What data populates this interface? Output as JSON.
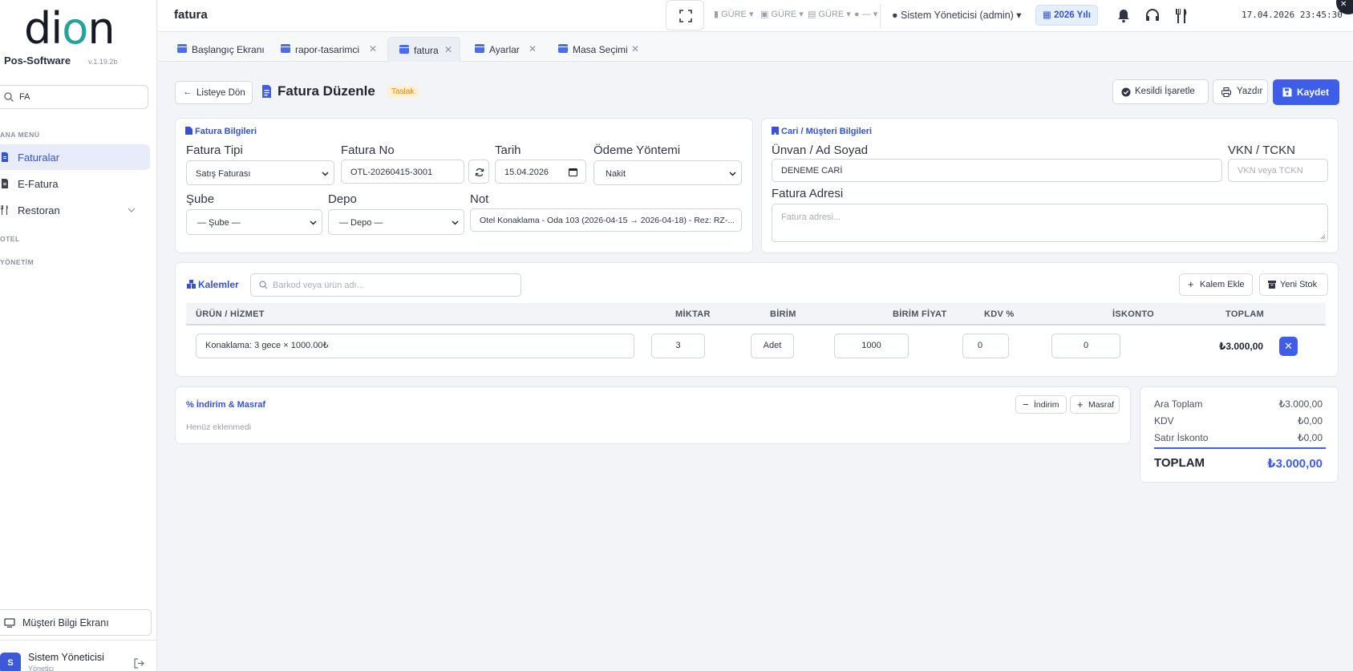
{
  "app": {
    "logo": "dion",
    "brand": "Pos-Software",
    "version": "v.1.19.2b"
  },
  "sidebar": {
    "search_value": "FA",
    "sections": [
      "ANA MENÜ",
      "OTEL",
      "YÖNETİM"
    ],
    "items": [
      {
        "label": "Faturalar",
        "icon": "file-invoice-icon",
        "active": true
      },
      {
        "label": "E-Fatura",
        "icon": "file-icon",
        "active": false
      },
      {
        "label": "Restoran",
        "icon": "utensils-icon",
        "active": false
      }
    ],
    "customer_screen": "Müşteri Bilgi Ekranı",
    "user": {
      "initial": "S",
      "name": "Sistem Yöneticisi",
      "role": "Yönetici"
    }
  },
  "topbar": {
    "title": "fatura",
    "stations": [
      "GÜRE",
      "GÜRE",
      "GÜRE",
      "—"
    ],
    "admin": "Sistem Yöneticisi (admin)",
    "year": "2026 Yılı",
    "clock": "17.04.2026 23:45:30"
  },
  "tabs": [
    {
      "label": "Başlangıç Ekranı",
      "closable": false
    },
    {
      "label": "rapor-tasarimci",
      "closable": true
    },
    {
      "label": "fatura",
      "closable": true,
      "active": true
    },
    {
      "label": "Ayarlar",
      "closable": true
    },
    {
      "label": "Masa Seçimi",
      "closable": true
    }
  ],
  "header": {
    "back_label": "Listeye Dön",
    "title": "Fatura Düzenle",
    "status": "Taslak",
    "mark_issued": "Kesildi İşaretle",
    "print": "Yazdır",
    "save": "Kaydet"
  },
  "invoice_info": {
    "title": "Fatura Bilgileri",
    "type_label": "Fatura Tipi",
    "type_value": "Satış Faturası",
    "no_label": "Fatura No",
    "no_value": "OTL-20260415-3001",
    "date_label": "Tarih",
    "date_value": "15.04.2026",
    "payment_label": "Ödeme Yöntemi",
    "payment_value": "Nakit",
    "branch_label": "Şube",
    "branch_value": "— Şube —",
    "warehouse_label": "Depo",
    "warehouse_value": "— Depo —",
    "note_label": "Not",
    "note_value": "Otel Konaklama - Oda 103 (2026-04-15 → 2026-04-18) - Rez: RZ-..."
  },
  "customer_info": {
    "title": "Cari / Müşteri Bilgileri",
    "name_label": "Ünvan / Ad Soyad",
    "name_value": "DENEME CARİ",
    "tax_label": "VKN / TCKN",
    "tax_placeholder": "VKN veya TCKN",
    "address_label": "Fatura Adresi",
    "address_placeholder": "Fatura adresi..."
  },
  "items": {
    "title": "Kalemler",
    "search_placeholder": "Barkod veya ürün adı...",
    "add_item": "Kalem Ekle",
    "new_stock": "Yeni Stok",
    "columns": [
      "ÜRÜN / HİZMET",
      "MİKTAR",
      "BİRİM",
      "BİRİM FİYAT",
      "KDV %",
      "İSKONTO",
      "TOPLAM"
    ],
    "rows": [
      {
        "product": "Konaklama: 3 gece × 1000.00₺",
        "qty": "3",
        "unit": "Adet",
        "price": "1000",
        "vat": "0",
        "discount": "0",
        "total": "₺3.000,00"
      }
    ]
  },
  "discounts": {
    "title": "İndirim & Masraf",
    "discount_btn": "İndirim",
    "expense_btn": "Masraf",
    "empty": "Henüz eklenmedi"
  },
  "totals": {
    "subtotal_label": "Ara Toplam",
    "subtotal": "₺3.000,00",
    "vat_label": "KDV",
    "vat": "₺0,00",
    "line_discount_label": "Satır İskonto",
    "line_discount": "₺0,00",
    "grand_label": "TOPLAM",
    "grand": "₺3.000,00"
  },
  "colors": {
    "primary": "#3d5ee8",
    "accent_teal": "#25a39a",
    "draft": "#d9891a"
  }
}
